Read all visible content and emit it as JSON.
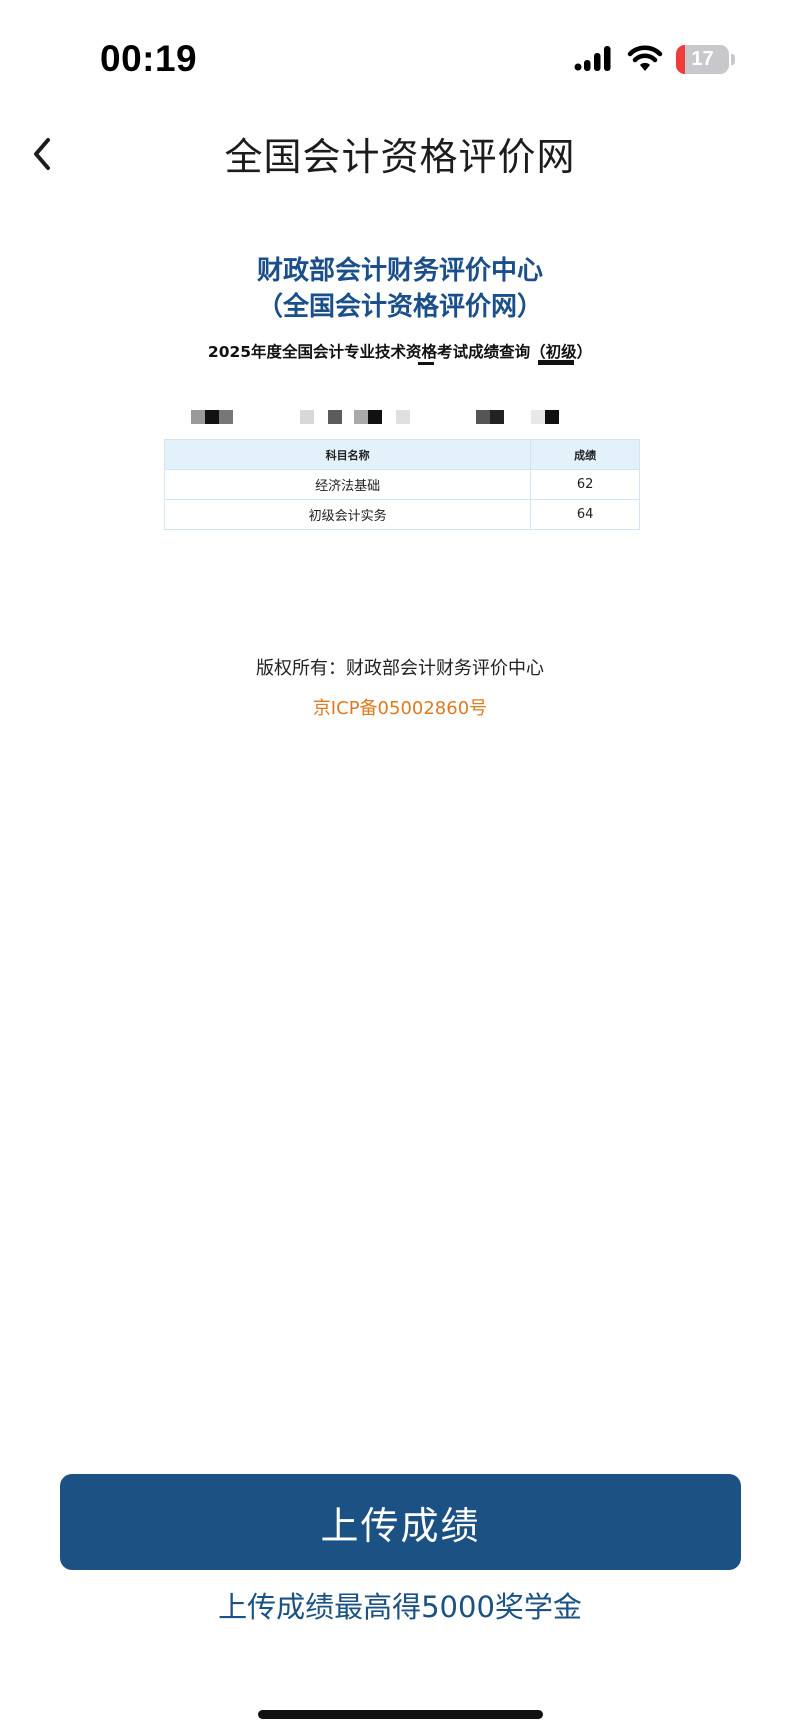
{
  "status_bar": {
    "time": "00:19",
    "battery_level": "17",
    "battery_fraction": 0.17,
    "icons": [
      "signal-icon",
      "wifi-icon",
      "battery-icon"
    ]
  },
  "nav": {
    "title": "全国会计资格评价网",
    "back_icon": "chevron-left-icon"
  },
  "content": {
    "org_line1": "财政部会计财务评价中心",
    "org_line2": "（全国会计资格评价网）",
    "query_title": "2025年度全国会计专业技术资格考试成绩查询（初级）",
    "table": {
      "headers": [
        "科目名称",
        "成绩"
      ],
      "rows": [
        [
          "经济法基础",
          "62"
        ],
        [
          "初级会计实务",
          "64"
        ]
      ]
    },
    "copyright": "版权所有：财政部会计财务评价中心",
    "icp": "京ICP备05002860号"
  },
  "actions": {
    "upload_label": "上传成绩",
    "promo": "上传成绩最高得5000奖学金"
  },
  "colors": {
    "brand_blue": "#1b5283",
    "org_blue": "#1b4f8a",
    "link_orange": "#e07a1f",
    "table_header_bg": "#e3f1fb",
    "battery_red": "#ef3b3b"
  }
}
